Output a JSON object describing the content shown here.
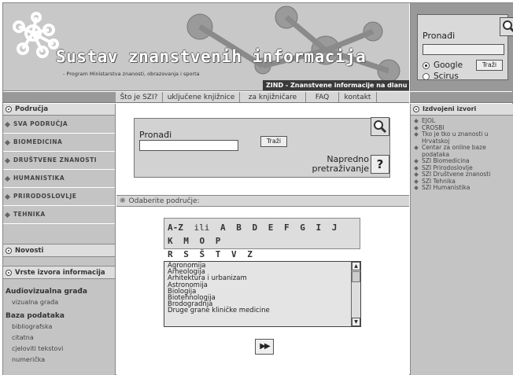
{
  "header": {
    "title": "Sustav znanstvenih informacija",
    "subtitle": "- Program Ministarstva znanosti, obrazovanja i sporta",
    "zind": "ZIND - Znanstvene informacije na dlanu"
  },
  "top_search": {
    "label": "Pronađi",
    "input_value": "",
    "button": "Traži",
    "options": [
      "Google",
      "Scirus"
    ],
    "selected": "Google"
  },
  "nav": {
    "items": [
      "Što je SZI?",
      "uključene knjižnice",
      "za knjižničare",
      "FAQ",
      "kontakt"
    ]
  },
  "left": {
    "areas_title": "Područja",
    "areas": [
      "SVA PODRUČJA",
      "BIOMEDICINA",
      "DRUŠTVENE ZNANOSTI",
      "HUMANISTIKA",
      "PRIRODOSLOVLJE",
      "TEHNIKA"
    ],
    "news_title": "Novosti",
    "sources_title": "Vrste izvora informacija",
    "groups": [
      {
        "heading": "Audiovizualna građa",
        "items": [
          "vizualna građa"
        ]
      },
      {
        "heading": "Baza podataka",
        "items": [
          "bibliografska",
          "citatna",
          "cjeloviti tekstovi",
          "numerička"
        ]
      }
    ]
  },
  "main": {
    "search_label": "Pronađi",
    "search_value": "",
    "search_button": "Traži",
    "advanced": "Napredno pretraživanje",
    "help": "?",
    "area_bar": "Odaberite područje:",
    "alphabet": [
      "A-Z",
      "ili",
      "A",
      "B",
      "D",
      "E",
      "F",
      "G",
      "I",
      "J",
      "K",
      "M",
      "O",
      "P",
      "R",
      "S",
      "Š",
      "T",
      "V",
      "Z"
    ],
    "list": [
      "Agronomija",
      "Arheologija",
      "Arhitektura i urbanizam",
      "Astronomija",
      "Biologija",
      "Biotehnologija",
      "Brodogradnja",
      "Druge grane kliničke medicine"
    ],
    "go_button": "▶▶"
  },
  "right": {
    "title": "Izdvojeni izvori",
    "items": [
      "EJOL",
      "CROSBI",
      "Tko je tko u znanosti u Hrvatskoj",
      "Centar za online baze podataka",
      "SZI Biomedicina",
      "SZI Prirodoslovlje",
      "SZI Društvene znanosti",
      "SZI Tehnika",
      "SZI Humanistika"
    ]
  },
  "colors": {
    "header_bg": "#c8c8c8",
    "side_bg": "#c4c4c4",
    "nav_bg": "#d6d6d6",
    "zind_bg": "#3a3a3a"
  }
}
